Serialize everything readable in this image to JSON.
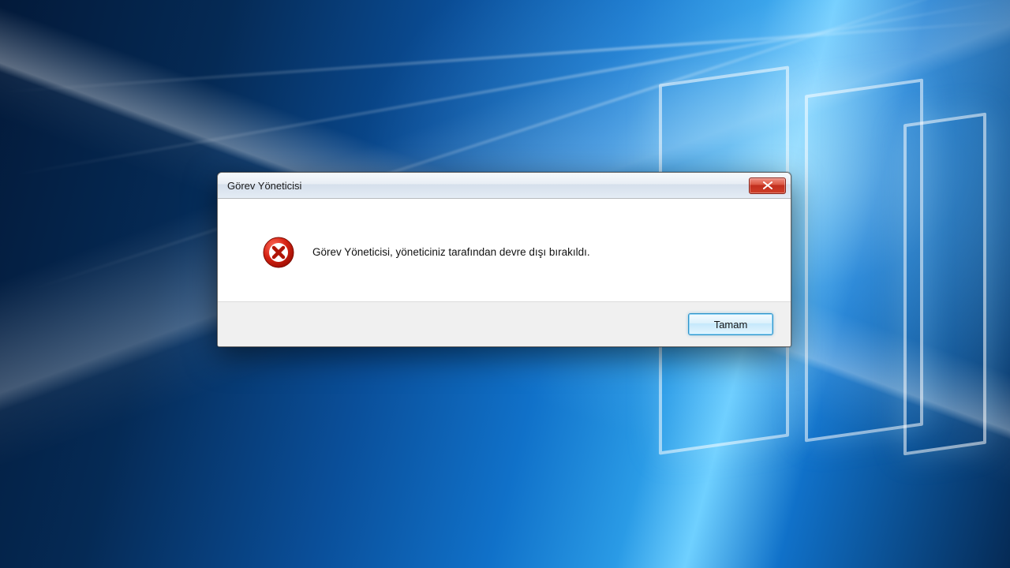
{
  "dialog": {
    "title": "Görev Yöneticisi",
    "message": "Görev Yöneticisi, yöneticiniz tarafından devre dışı bırakıldı.",
    "ok_label": "Tamam"
  },
  "icons": {
    "close": "close-icon",
    "error": "error-circle-x-icon"
  },
  "colors": {
    "error_red": "#c21f12",
    "close_red": "#c12e1f",
    "ok_border": "#2f93c8"
  }
}
